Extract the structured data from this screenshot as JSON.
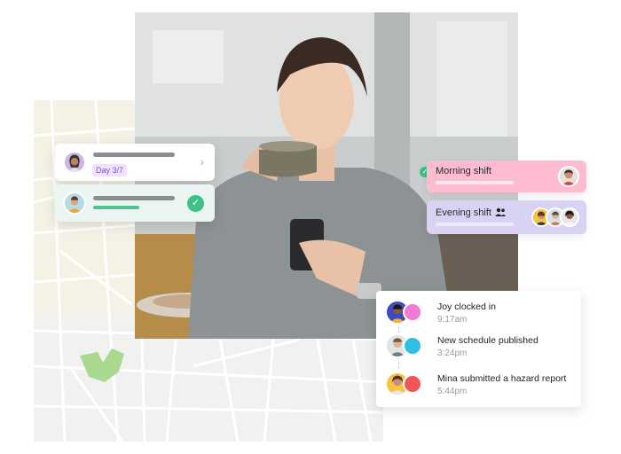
{
  "left_cards": {
    "day_badge": "Day 3/7",
    "chevron": "›",
    "check": "✓"
  },
  "shifts": {
    "morning_label": "Morning shift",
    "evening_label": "Evening shift",
    "check": "✓"
  },
  "activity": [
    {
      "title": "Joy clocked in",
      "time": "9:17am",
      "icon": "clock-icon",
      "color": "#f07ad4"
    },
    {
      "title": "New schedule published",
      "time": "3:24pm",
      "icon": "calendar-icon",
      "color": "#32bde6"
    },
    {
      "title": "Mina submitted a hazard report",
      "time": "5:44pm",
      "icon": "report-icon",
      "color": "#f2545b"
    }
  ],
  "colors": {
    "morning": "#fdbcd0",
    "evening": "#d9d2f3",
    "success": "#3ec184",
    "badge_purple": "#8a4fd0"
  }
}
